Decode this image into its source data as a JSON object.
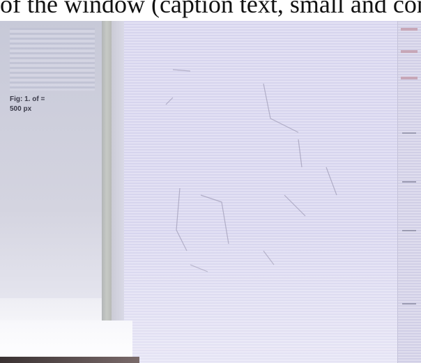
{
  "caption": {
    "text": "of the window (caption text, small and compact)"
  },
  "panel": {
    "status_text": "Fig: 1. of =\n500 px"
  },
  "colors": {
    "background": "#dcdcec",
    "canvas": "#e0def2",
    "panel": "#cfd0dc",
    "divider": "#b8bab7",
    "accent": "#c7a7b7"
  },
  "icons": {
    "divider_handle": "splitter-handle-icon"
  }
}
